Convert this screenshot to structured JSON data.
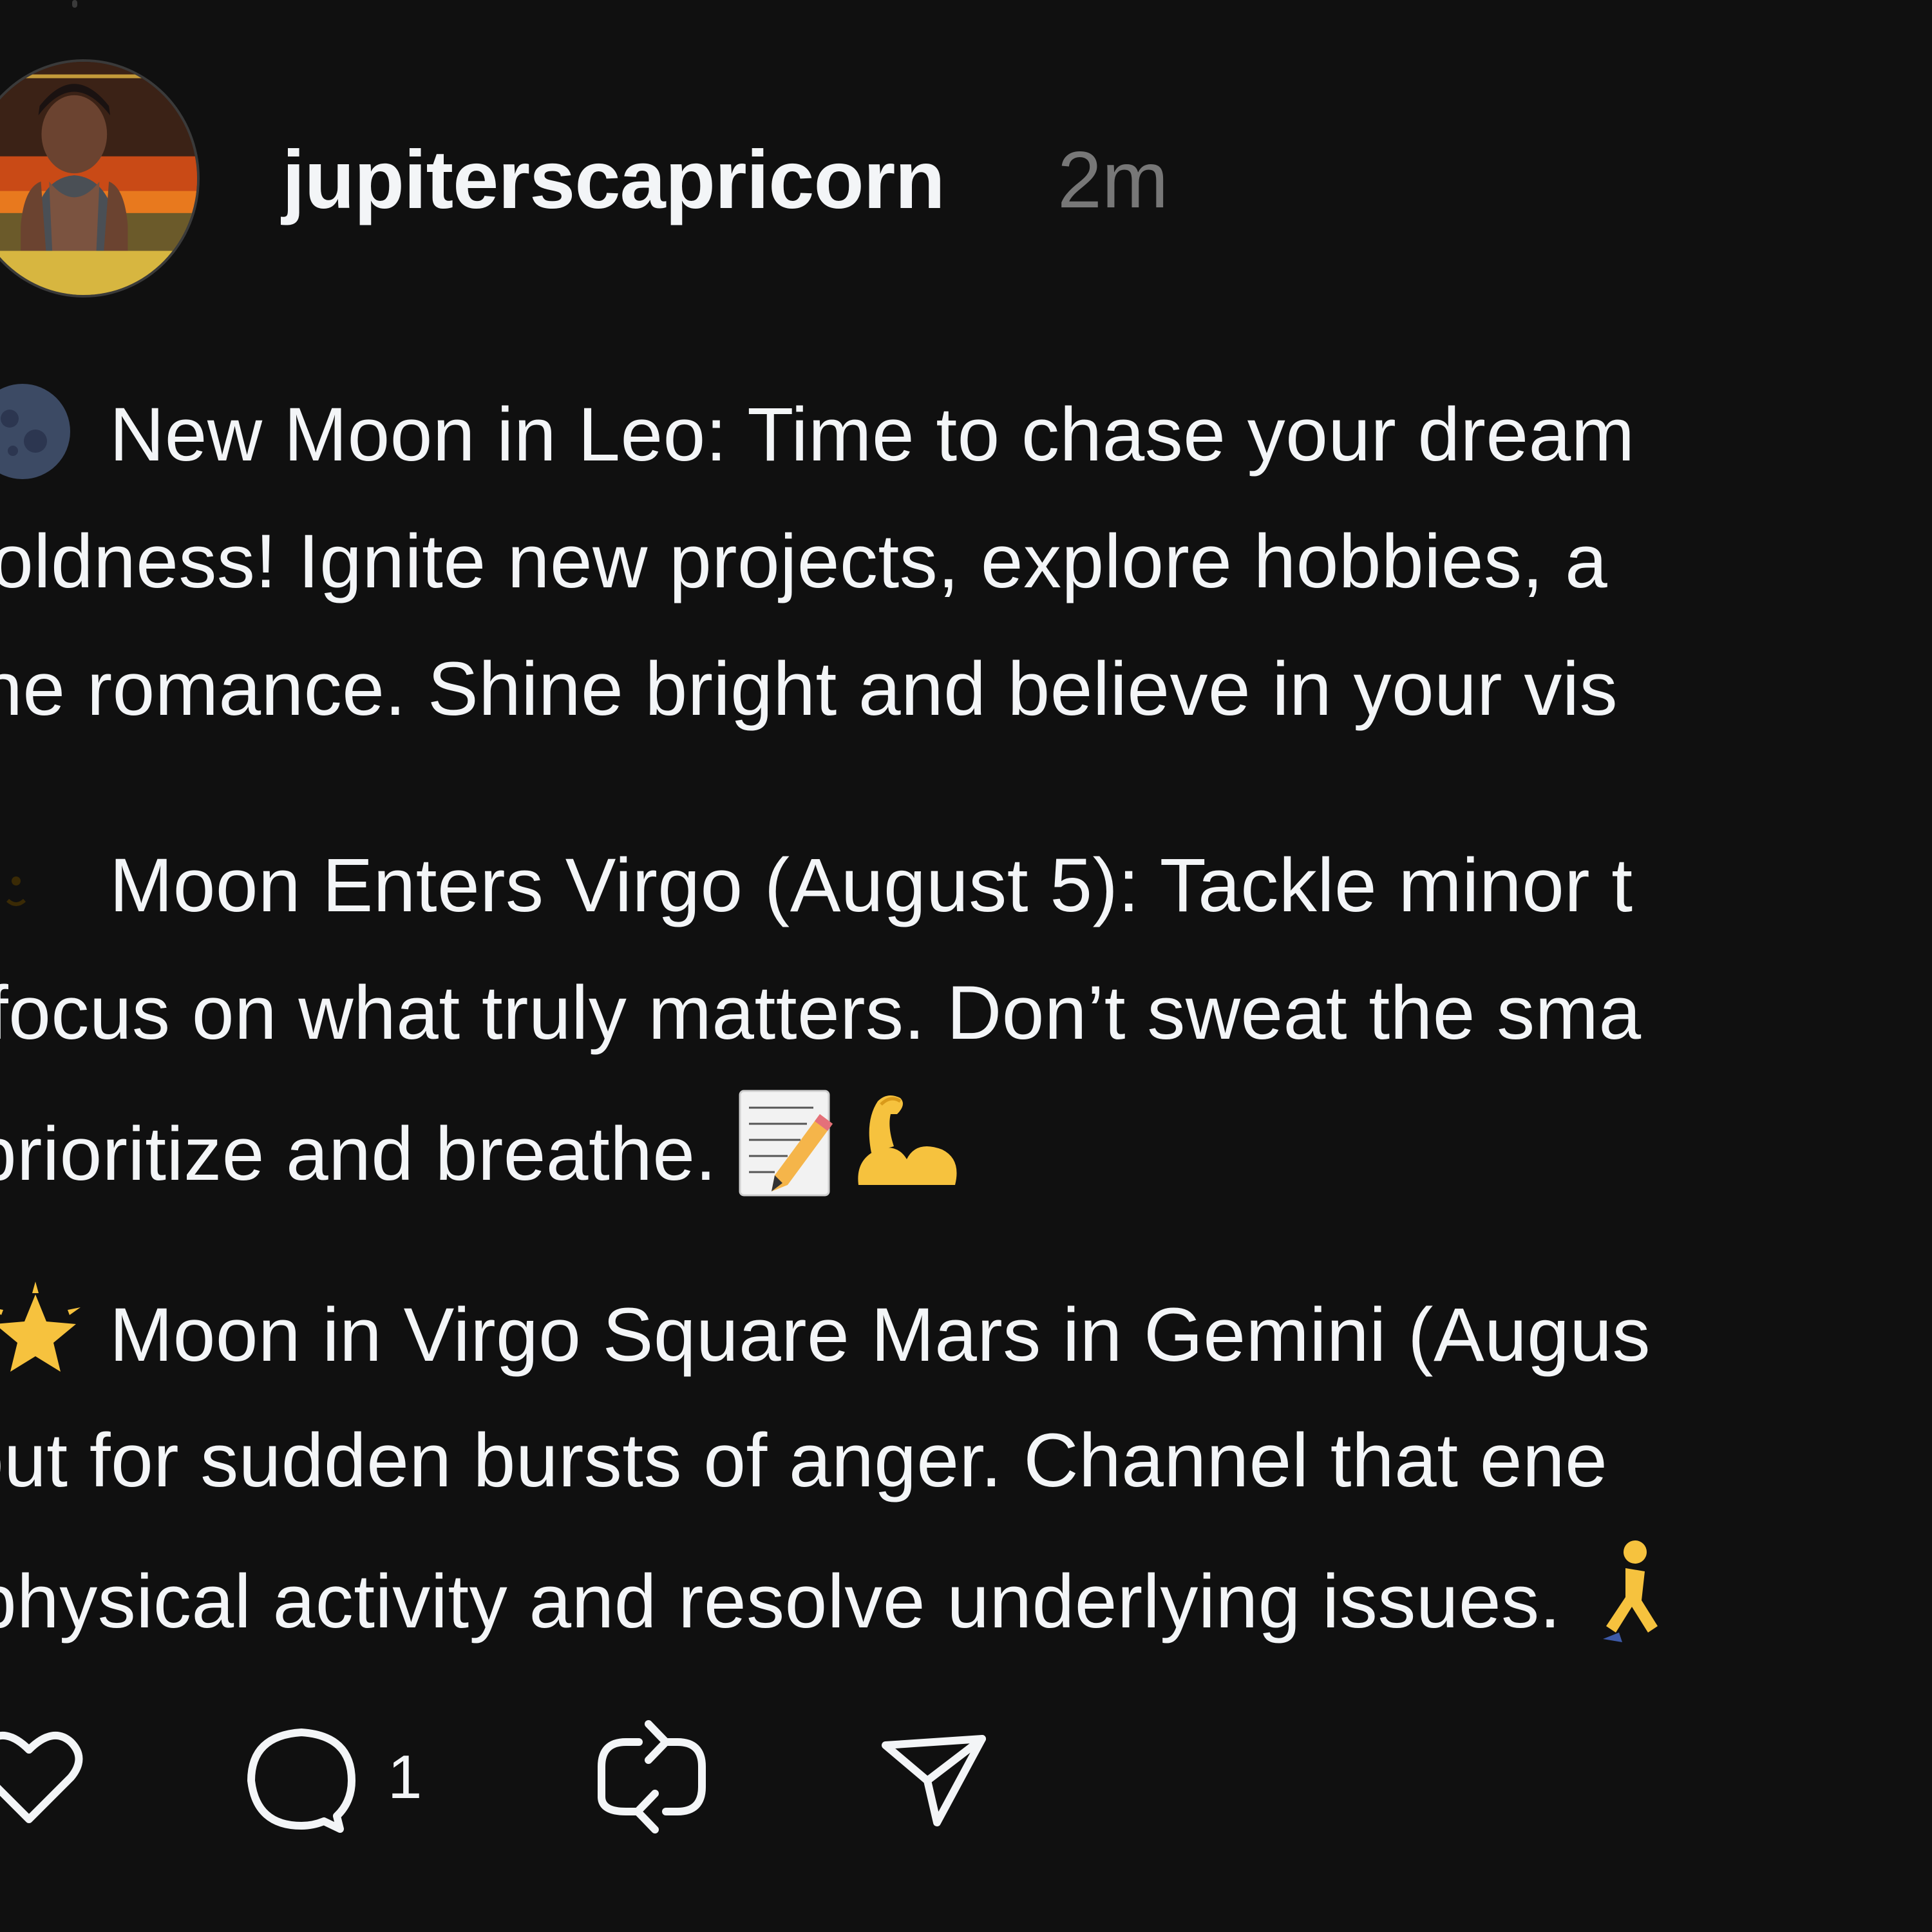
{
  "post": {
    "author": {
      "username": "jupiterscapricorn",
      "avatar": "profile-photo"
    },
    "timestamp": "2m",
    "paragraphs": [
      {
        "emoji": "new-moon-emoji",
        "lines": [
          "New Moon in Leo: Time to chase your dream",
          "boldness! Ignite new projects, explore hobbies, a",
          "the romance. Shine bright and believe in your vis"
        ]
      },
      {
        "emoji": "crescent-moon-emoji",
        "lines": [
          "Moon Enters Virgo (August 5): Tackle minor t",
          "focus on what truly matters. Don’t sweat the sma",
          "prioritize and breathe."
        ],
        "trailing_emojis": [
          "memo-emoji",
          "flexed-biceps-emoji"
        ]
      },
      {
        "emoji": "glowing-star-emoji",
        "lines": [
          "Moon in Virgo Square Mars in Gemini (Augus",
          "out for sudden bursts of anger. Channel that ene",
          "physical activity and resolve underlying issues."
        ],
        "trailing_emojis": [
          "person-running-emoji"
        ]
      }
    ],
    "actions": {
      "like": {
        "icon": "heart-icon"
      },
      "reply": {
        "icon": "speech-bubble-icon",
        "count": "1"
      },
      "repost": {
        "icon": "repost-icon"
      },
      "share": {
        "icon": "send-icon"
      }
    }
  },
  "colors": {
    "background": "#101010",
    "text": "#f3f5f7",
    "muted": "#777777"
  }
}
